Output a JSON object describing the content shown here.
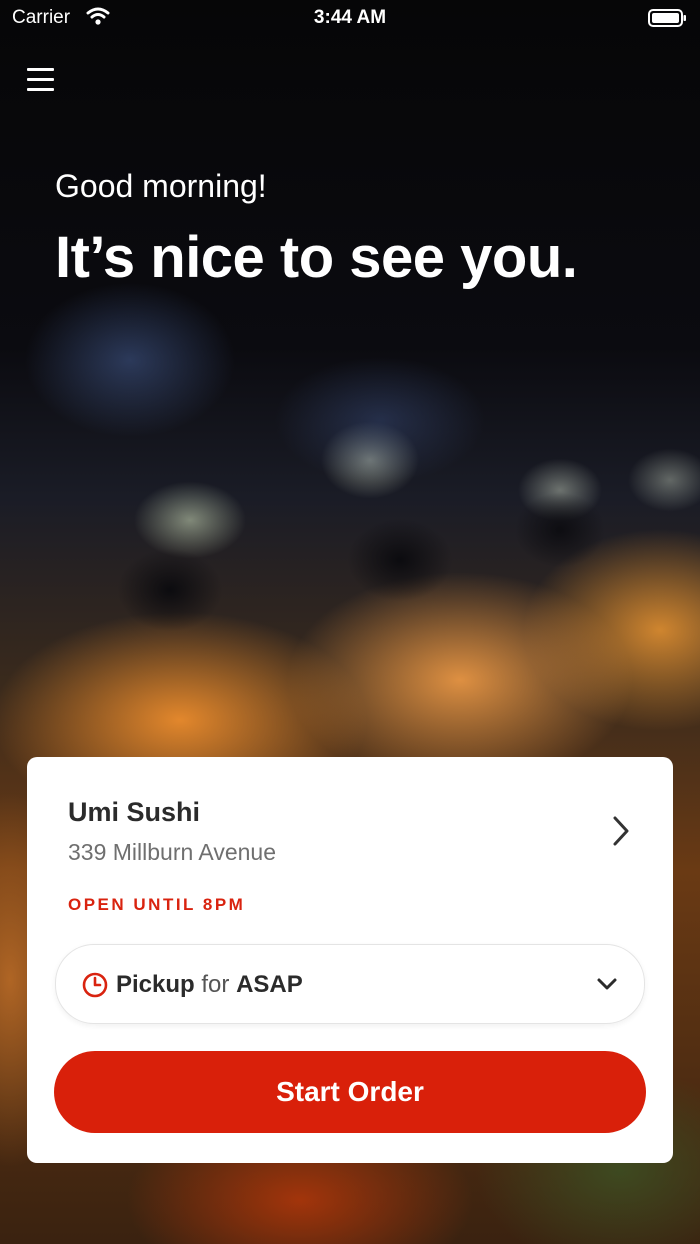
{
  "status_bar": {
    "carrier": "Carrier",
    "time": "3:44 AM",
    "icons": [
      "wifi-icon",
      "battery-icon"
    ]
  },
  "header": {
    "menu_icon": "hamburger-menu-icon",
    "greeting": "Good morning!",
    "headline": "It’s nice to see you."
  },
  "restaurant": {
    "name": "Umi Sushi",
    "address": "339 Millburn Avenue",
    "hours_status": "OPEN UNTIL 8PM"
  },
  "order_mode": {
    "mode": "Pickup",
    "connector": "for",
    "time": "ASAP",
    "icons": [
      "clock-icon",
      "chevron-down-icon"
    ]
  },
  "cta": {
    "label": "Start Order"
  },
  "colors": {
    "accent": "#d9200a",
    "status_text": "#d9230f"
  }
}
